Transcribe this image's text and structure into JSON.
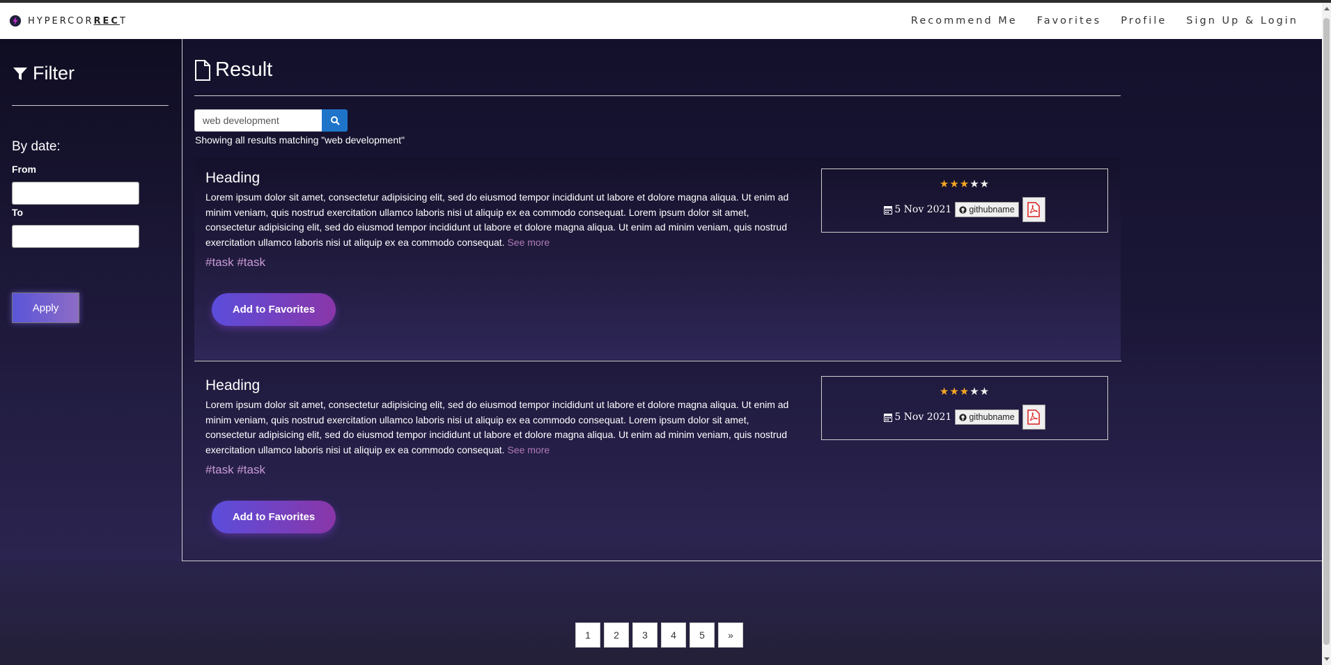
{
  "brand": {
    "text_plain": "HYPERCOR",
    "text_bold": "REC",
    "text_tail": "T",
    "logo_icon": "lightning-circle-icon"
  },
  "nav": {
    "items": [
      {
        "label": "Recommend Me"
      },
      {
        "label": "Favorites"
      },
      {
        "label": "Profile"
      },
      {
        "label": "Sign Up & Login"
      }
    ]
  },
  "sidebar": {
    "title": "Filter",
    "by_date": "By date:",
    "from_label": "From",
    "to_label": "To",
    "from_value": "",
    "to_value": "",
    "apply_label": "Apply"
  },
  "main": {
    "title": "Result",
    "search": {
      "value": "web development"
    },
    "showing_text": "Showing all results matching \"web development\"",
    "cards": [
      {
        "heading": "Heading",
        "body": "Lorem ipsum dolor sit amet, consectetur adipisicing elit, sed do eiusmod tempor incididunt ut labore et dolore magna aliqua. Ut enim ad minim veniam, quis nostrud exercitation ullamco laboris nisi ut aliquip ex ea commodo consequat. Lorem ipsum dolor sit amet, consectetur adipisicing elit, sed do eiusmod tempor incididunt ut labore et dolore magna aliqua. Ut enim ad minim veniam, quis nostrud exercitation ullamco laboris nisi ut aliquip ex ea commodo consequat.",
        "see_more": "See more",
        "tags": "#task #task",
        "favorites_label": "Add to Favorites",
        "rating": 3,
        "rating_max": 5,
        "date": "5 Nov 2021",
        "github": "githubname"
      },
      {
        "heading": "Heading",
        "body": "Lorem ipsum dolor sit amet, consectetur adipisicing elit, sed do eiusmod tempor incididunt ut labore et dolore magna aliqua. Ut enim ad minim veniam, quis nostrud exercitation ullamco laboris nisi ut aliquip ex ea commodo consequat. Lorem ipsum dolor sit amet, consectetur adipisicing elit, sed do eiusmod tempor incididunt ut labore et dolore magna aliqua. Ut enim ad minim veniam, quis nostrud exercitation ullamco laboris nisi ut aliquip ex ea commodo consequat.",
        "see_more": "See more",
        "tags": "#task #task",
        "favorites_label": "Add to Favorites",
        "rating": 3,
        "rating_max": 5,
        "date": "5 Nov 2021",
        "github": "githubname"
      }
    ]
  },
  "pagination": {
    "pages": [
      "1",
      "2",
      "3",
      "4",
      "5"
    ],
    "next": "»"
  },
  "colors": {
    "accent": "#1e74c9",
    "star": "#f5a623",
    "see_more": "#b07ab8",
    "tags": "#c99ad6"
  }
}
